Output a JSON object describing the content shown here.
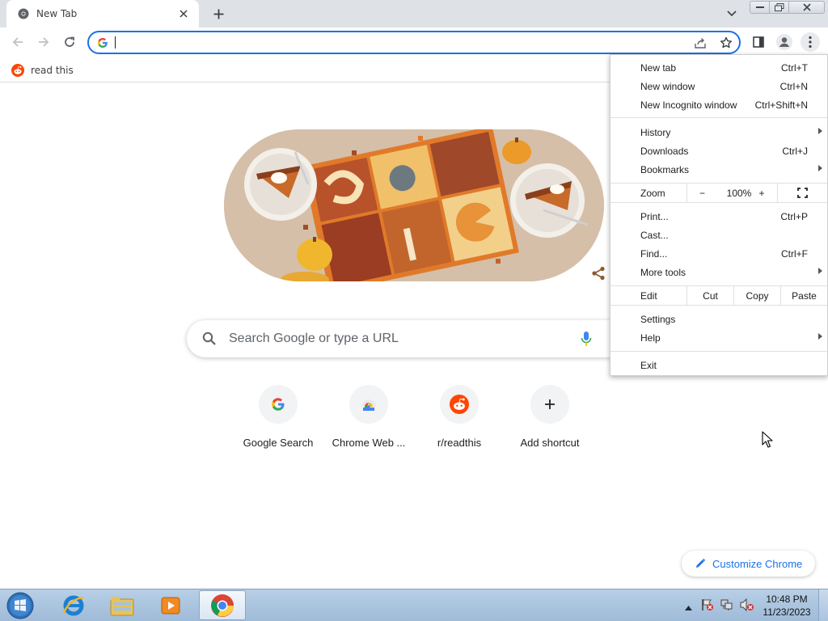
{
  "tab": {
    "title": "New Tab"
  },
  "toolbar": {
    "omnibox_value": "",
    "omnibox_placeholder": ""
  },
  "bookmarks": [
    {
      "label": "read this",
      "icon": "reddit-icon"
    }
  ],
  "ntp": {
    "search_placeholder": "Search Google or type a URL",
    "shortcuts": [
      {
        "label": "Google Search",
        "icon": "google-icon"
      },
      {
        "label": "Chrome Web ...",
        "icon": "chrome-web-store-icon"
      },
      {
        "label": "r/readthis",
        "icon": "reddit-icon"
      },
      {
        "label": "Add shortcut",
        "icon": "plus-icon"
      }
    ],
    "customize_label": "Customize Chrome"
  },
  "menu": {
    "new_tab": {
      "label": "New tab",
      "accel": "Ctrl+T"
    },
    "new_window": {
      "label": "New window",
      "accel": "Ctrl+N"
    },
    "new_incognito": {
      "label": "New Incognito window",
      "accel": "Ctrl+Shift+N"
    },
    "history": {
      "label": "History"
    },
    "downloads": {
      "label": "Downloads",
      "accel": "Ctrl+J"
    },
    "bookmarks": {
      "label": "Bookmarks"
    },
    "zoom": {
      "label": "Zoom",
      "minus": "−",
      "value": "100%",
      "plus": "+"
    },
    "print": {
      "label": "Print...",
      "accel": "Ctrl+P"
    },
    "cast": {
      "label": "Cast..."
    },
    "find": {
      "label": "Find...",
      "accel": "Ctrl+F"
    },
    "more_tools": {
      "label": "More tools"
    },
    "edit": {
      "label": "Edit",
      "cut": "Cut",
      "copy": "Copy",
      "paste": "Paste"
    },
    "settings": {
      "label": "Settings"
    },
    "help": {
      "label": "Help"
    },
    "exit": {
      "label": "Exit"
    }
  },
  "taskbar": {
    "time": "10:48 PM",
    "date": "11/23/2023",
    "apps": [
      "internet-explorer-icon",
      "file-explorer-icon",
      "media-player-icon",
      "chrome-icon"
    ]
  },
  "colors": {
    "accent": "#1a73e8",
    "tabstrip": "#dee1e6",
    "reddit": "#ff4500",
    "doodle_bg": "#d8c3ad"
  }
}
